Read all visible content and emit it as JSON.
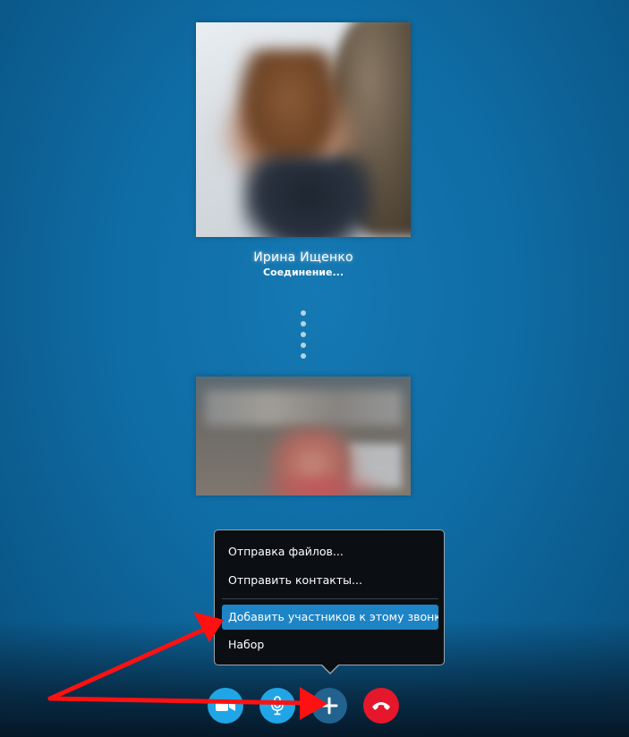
{
  "remote": {
    "name": "Ирина Ищенко",
    "status": "Соединение..."
  },
  "menu": {
    "items": [
      {
        "label": "Отправка файлов..."
      },
      {
        "label": "Отправить контакты..."
      },
      {
        "label": "Добавить участников к этому звонку...",
        "highlighted": true
      },
      {
        "label": "Набор"
      }
    ]
  },
  "controls": {
    "video_icon": "video-camera-icon",
    "mic_icon": "microphone-icon",
    "add_icon": "plus-icon",
    "hangup_icon": "phone-hangup-icon"
  },
  "colors": {
    "accent": "#1d84c6",
    "control_blue": "#20a6e6",
    "add_button": "#22628f",
    "hangup_red": "#e5172b",
    "annotation_arrow": "#ff1111"
  }
}
